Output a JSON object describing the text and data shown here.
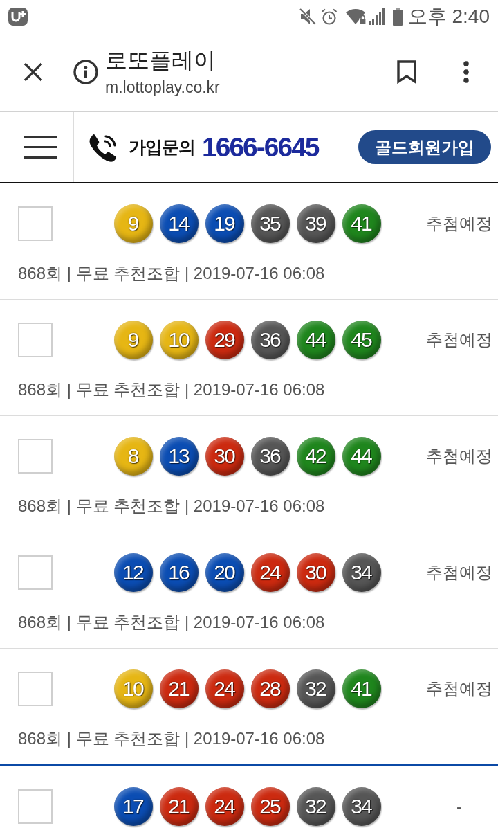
{
  "status_bar": {
    "time": "오후 2:40"
  },
  "browser_bar": {
    "title": "로또플레이",
    "url": "m.lottoplay.co.kr"
  },
  "site_header": {
    "inquiry_label": "가입문의",
    "phone": "1666-6645",
    "join_button": "골드회원가입"
  },
  "combinations": [
    {
      "group_start": false,
      "checked": false,
      "balls": [
        {
          "number": "9",
          "color": "#e6b614"
        },
        {
          "number": "14",
          "color": "#0b4db3"
        },
        {
          "number": "19",
          "color": "#0b4db3"
        },
        {
          "number": "35",
          "color": "#565656"
        },
        {
          "number": "39",
          "color": "#565656"
        },
        {
          "number": "41",
          "color": "#1f861d"
        }
      ],
      "status": "추첨예정",
      "info": "868회 | 무료 추천조합 | 2019-07-16 06:08"
    },
    {
      "group_start": false,
      "checked": false,
      "balls": [
        {
          "number": "9",
          "color": "#e6b614"
        },
        {
          "number": "10",
          "color": "#e6b614"
        },
        {
          "number": "29",
          "color": "#cc2a10"
        },
        {
          "number": "36",
          "color": "#565656"
        },
        {
          "number": "44",
          "color": "#1f861d"
        },
        {
          "number": "45",
          "color": "#1f861d"
        }
      ],
      "status": "추첨예정",
      "info": "868회 | 무료 추천조합 | 2019-07-16 06:08"
    },
    {
      "group_start": false,
      "checked": false,
      "balls": [
        {
          "number": "8",
          "color": "#e6b614"
        },
        {
          "number": "13",
          "color": "#0b4db3"
        },
        {
          "number": "30",
          "color": "#cc2a10"
        },
        {
          "number": "36",
          "color": "#565656"
        },
        {
          "number": "42",
          "color": "#1f861d"
        },
        {
          "number": "44",
          "color": "#1f861d"
        }
      ],
      "status": "추첨예정",
      "info": "868회 | 무료 추천조합 | 2019-07-16 06:08"
    },
    {
      "group_start": false,
      "checked": false,
      "balls": [
        {
          "number": "12",
          "color": "#0b4db3"
        },
        {
          "number": "16",
          "color": "#0b4db3"
        },
        {
          "number": "20",
          "color": "#0b4db3"
        },
        {
          "number": "24",
          "color": "#cc2a10"
        },
        {
          "number": "30",
          "color": "#cc2a10"
        },
        {
          "number": "34",
          "color": "#565656"
        }
      ],
      "status": "추첨예정",
      "info": "868회 | 무료 추천조합 | 2019-07-16 06:08"
    },
    {
      "group_start": false,
      "checked": false,
      "balls": [
        {
          "number": "10",
          "color": "#e6b614"
        },
        {
          "number": "21",
          "color": "#cc2a10"
        },
        {
          "number": "24",
          "color": "#cc2a10"
        },
        {
          "number": "28",
          "color": "#cc2a10"
        },
        {
          "number": "32",
          "color": "#565656"
        },
        {
          "number": "41",
          "color": "#1f861d"
        }
      ],
      "status": "추첨예정",
      "info": "868회 | 무료 추천조합 | 2019-07-16 06:08"
    },
    {
      "group_start": true,
      "checked": false,
      "balls": [
        {
          "number": "17",
          "color": "#0b4db3"
        },
        {
          "number": "21",
          "color": "#cc2a10"
        },
        {
          "number": "24",
          "color": "#cc2a10"
        },
        {
          "number": "25",
          "color": "#cc2a10"
        },
        {
          "number": "32",
          "color": "#565656"
        },
        {
          "number": "34",
          "color": "#565656"
        }
      ],
      "status": "-"
    }
  ]
}
